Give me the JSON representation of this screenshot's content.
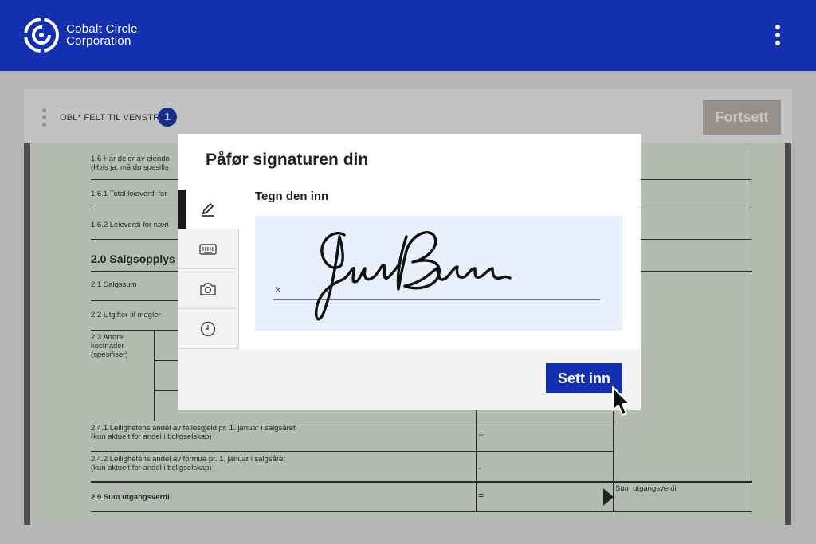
{
  "header": {
    "brand_line1": "Cobalt Circle",
    "brand_line2": "Corporation"
  },
  "toolbar": {
    "required_label": "OBL* FELT TIL VENSTRE",
    "required_count": "1",
    "continue_label": "Fortsett"
  },
  "document": {
    "rows": [
      {
        "text": "1.6 Har deler av eiendo\n(Hvis ja, må du spesifis"
      },
      {
        "text": "1.6.1 Total leieverdi for"
      },
      {
        "text": "1.6.2 Leieverdi for næri"
      },
      {
        "text": "2.1 Salgssum"
      },
      {
        "text": "2.2 Utgifter til megler"
      },
      {
        "text": "2.3 Andre\nkostnader\n(spesifiser)"
      },
      {
        "text": "2.4.1 Leilighetens andel av fellesgjeld pr. 1. januar i salgsåret\n(kun aktuelt for andel i boligselskap)"
      },
      {
        "text": "2.4.2 Leilighetens andel av formue pr. 1. januar i salgsåret\n(kun aktuelt for andel i boligselskap)"
      },
      {
        "text": "2.9 Sum utgangsverdi"
      }
    ],
    "section_title": "2.0 Salgsopplys",
    "symbols": [
      "+",
      "-",
      "="
    ],
    "sum_label": "Sum utgangsverdi"
  },
  "modal": {
    "title": "Påfør signaturen din",
    "draw_label": "Tegn den inn",
    "clear_symbol": "×",
    "insert_label": "Sett inn",
    "tabs": [
      {
        "icon": "pen-icon",
        "active": true
      },
      {
        "icon": "keyboard-icon",
        "active": false
      },
      {
        "icon": "camera-icon",
        "active": false
      },
      {
        "icon": "clock-icon",
        "active": false
      }
    ]
  },
  "colors": {
    "brand": "#1330b0",
    "signature_pad": "#e8effd",
    "disabled_button": "#bdb7ad"
  }
}
